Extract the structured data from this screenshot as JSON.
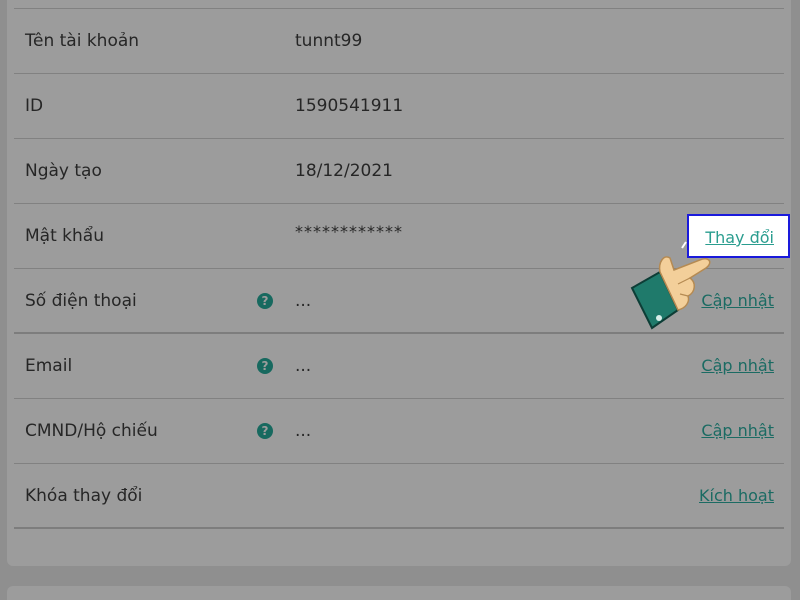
{
  "rows": [
    {
      "label": "Tên tài khoản",
      "value": "tunnt99"
    },
    {
      "label": "ID",
      "value": "1590541911"
    },
    {
      "label": "Ngày tạo",
      "value": "18/12/2021"
    },
    {
      "label": "Mật khẩu",
      "value": "************",
      "action": "Thay đổi"
    },
    {
      "label": "Số điện thoại",
      "help": "?",
      "value": "...",
      "action": "Cập nhật"
    },
    {
      "label": "Email",
      "help": "?",
      "value": "...",
      "action": "Cập nhật"
    },
    {
      "label": "CMND/Hộ chiếu",
      "help": "?",
      "value": "...",
      "action": "Cập nhật"
    },
    {
      "label": "Khóa thay đổi",
      "action": "Kích hoạt"
    }
  ],
  "colors": {
    "accent": "#1b6b63",
    "highlight_border": "#1a1adb",
    "overlay": "#9c9c9c"
  },
  "icons": {
    "help": "question-circle-icon",
    "pointer": "pointing-hand-icon"
  }
}
